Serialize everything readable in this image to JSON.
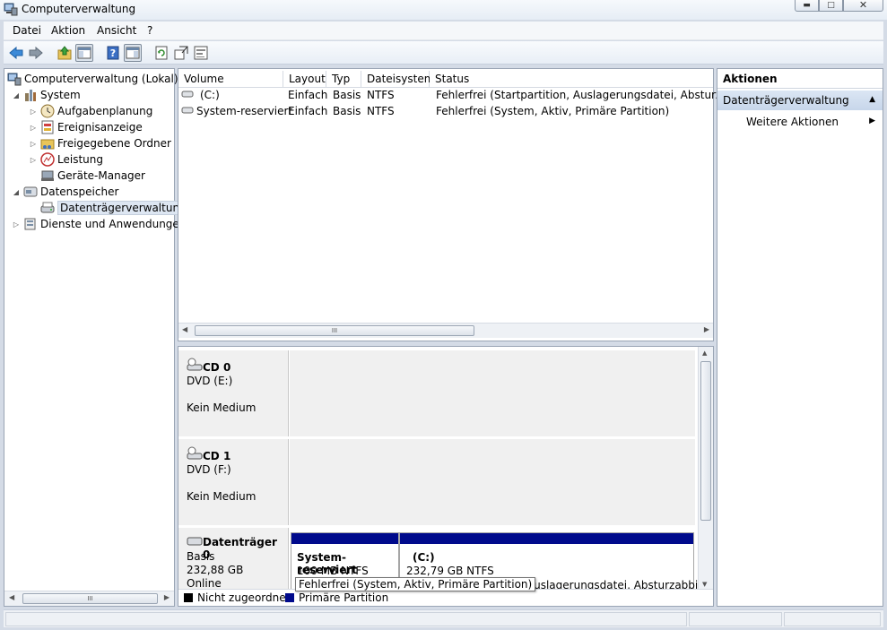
{
  "window": {
    "title": "Computerverwaltung"
  },
  "menu": {
    "items": [
      "Datei",
      "Aktion",
      "Ansicht",
      "?"
    ]
  },
  "toolbar": {
    "buttons": [
      "back-arrow-icon",
      "forward-arrow-icon",
      "up-folder-icon",
      "show-hide-tree-icon",
      "help-icon",
      "show-hide-action-pane-icon",
      "refresh-icon",
      "export-list-icon",
      "properties-icon"
    ]
  },
  "tree": {
    "items": [
      {
        "label": "Computerverwaltung (Lokal)",
        "icon": "computer-management-icon",
        "expander": ""
      },
      {
        "label": "System",
        "icon": "system-tools-icon",
        "expander": "◢"
      },
      {
        "label": "Aufgabenplanung",
        "icon": "clock-icon",
        "expander": "▷"
      },
      {
        "label": "Ereignisanzeige",
        "icon": "event-viewer-icon",
        "expander": "▷"
      },
      {
        "label": "Freigegebene Ordner",
        "icon": "shared-folder-icon",
        "expander": "▷"
      },
      {
        "label": "Leistung",
        "icon": "performance-icon",
        "expander": "▷"
      },
      {
        "label": "Geräte-Manager",
        "icon": "device-manager-icon",
        "expander": ""
      },
      {
        "label": "Datenspeicher",
        "icon": "storage-icon",
        "expander": "◢"
      },
      {
        "label": "Datenträgerverwaltung",
        "icon": "disk-management-icon",
        "expander": ""
      },
      {
        "label": "Dienste und Anwendungen",
        "icon": "services-icon",
        "expander": "▷"
      }
    ],
    "scroll_thumb": "III"
  },
  "volumes": {
    "columns": [
      "Volume",
      "Layout",
      "Typ",
      "Dateisystem",
      "Status"
    ],
    "rows": [
      {
        "volume": "(C:)",
        "layout": "Einfach",
        "typ": "Basis",
        "fs": "NTFS",
        "status": "Fehlerfrei (Startpartition, Auslagerungsdatei, Absturzabbild"
      },
      {
        "volume": "System-reserviert",
        "layout": "Einfach",
        "typ": "Basis",
        "fs": "NTFS",
        "status": "Fehlerfrei (System, Aktiv, Primäre Partition)"
      }
    ],
    "scroll_thumb": "III"
  },
  "disks": [
    {
      "name": "CD 0",
      "line1": "DVD (E:)",
      "line2": "Kein Medium"
    },
    {
      "name": "CD 1",
      "line1": "DVD (F:)",
      "line2": "Kein Medium"
    },
    {
      "name": "Datenträger 0",
      "line1": "Basis",
      "line2": "232,88 GB",
      "line3": "Online"
    }
  ],
  "partitions": [
    {
      "name": "System-reserviert",
      "size": "100 MB NTFS",
      "status": "Fehlerfrei (System, Aktiv, Primäre Partition)"
    },
    {
      "name": "(C:)",
      "size": "232,79 GB NTFS",
      "status": "ion, Auslagerungsdatei, Absturzabbild,"
    }
  ],
  "legend": [
    {
      "label": "Nicht zugeordnet",
      "color": "#000000"
    },
    {
      "label": "Primäre Partition",
      "color": "#000a8c"
    }
  ],
  "actions": {
    "header": "Aktionen",
    "section": "Datenträgerverwaltung",
    "item": "Weitere Aktionen"
  },
  "tooltip": "Fehlerfrei (System, Aktiv, Primäre Partition)"
}
